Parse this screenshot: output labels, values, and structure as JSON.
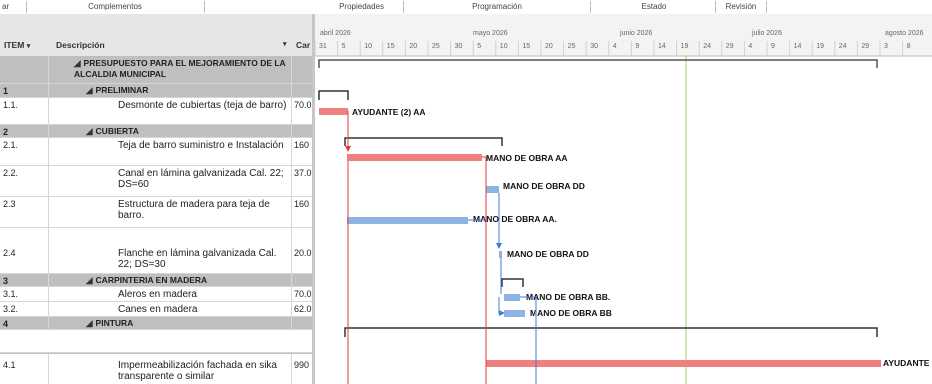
{
  "ribbon": {
    "groups": [
      "ar",
      "Complementos",
      "Propiedades",
      "Programación",
      "Estado",
      "Revisión"
    ]
  },
  "table": {
    "headers": {
      "item": "ITEM",
      "description": "Descripción",
      "cost": "Car"
    },
    "rows": [
      {
        "item": "",
        "description": "PRESUPUESTO PARA EL MEJORAMIENTO DE LA ALCALDIA MUNICIPAL",
        "num": "",
        "type": "summary"
      },
      {
        "item": "1",
        "description": "PRELIMINAR",
        "num": "",
        "type": "summary"
      },
      {
        "item": "1.1.",
        "description": "Desmonte de cubiertas (teja de barro)",
        "num": "70.0",
        "type": "task"
      },
      {
        "item": "2",
        "description": "CUBIERTA",
        "num": "",
        "type": "summary"
      },
      {
        "item": "2.1.",
        "description": "Teja de barro suministro e Instalación",
        "num": "160",
        "type": "task"
      },
      {
        "item": "2.2.",
        "description": "Canal en lámina galvanizada Cal. 22; DS=60",
        "num": "37.0",
        "type": "task"
      },
      {
        "item": "2.3",
        "description": "Estructura de madera para teja de barro.",
        "num": "160",
        "type": "task"
      },
      {
        "item": "2.4",
        "description": "Flanche en lámina galvanizada Cal. 22; DS=30",
        "num": "20.0",
        "type": "task"
      },
      {
        "item": "3",
        "description": "CARPINTERIA EN MADERA",
        "num": "",
        "type": "summary"
      },
      {
        "item": "3.1.",
        "description": "Aleros en madera",
        "num": "70.0",
        "type": "task"
      },
      {
        "item": "3.2.",
        "description": "Canes en madera",
        "num": "62.0",
        "type": "task"
      },
      {
        "item": "4",
        "description": "PINTURA",
        "num": "",
        "type": "summary"
      },
      {
        "item": "4.1",
        "description": "Impermeabilización fachada en sika transparente o similar",
        "num": "990",
        "type": "task"
      }
    ]
  },
  "timeline": {
    "months": [
      "abril 2026",
      "mayo 2026",
      "junio 2026",
      "julio 2026",
      "agosto 2026"
    ],
    "days": [
      "31",
      "5",
      "10",
      "15",
      "20",
      "25",
      "30",
      "5",
      "10",
      "15",
      "20",
      "25",
      "30",
      "4",
      "9",
      "14",
      "19",
      "24",
      "29",
      "4",
      "9",
      "14",
      "19",
      "24",
      "29",
      "3",
      "8"
    ]
  },
  "gantt": {
    "resources": [
      "AYUDANTE (2) AA",
      "MANO DE OBRA AA",
      "MANO DE OBRA DD",
      "MANO DE OBRA AA.",
      "MANO DE OBRA DD",
      "MANO DE OBRA BB.",
      "MANO DE OBRA BB",
      "AYUDANTE"
    ],
    "colors": {
      "critical": "#f08080",
      "normal": "#8eb4e3",
      "summary": "#333333",
      "link_critical": "#e23a3a",
      "link_normal": "#3d7fd1",
      "today": "#9ccc65"
    }
  }
}
